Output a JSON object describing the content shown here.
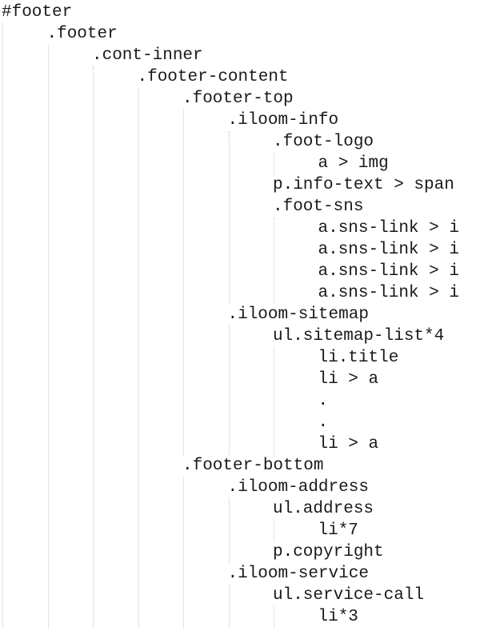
{
  "lines": [
    {
      "text": "#footer",
      "level": 0
    },
    {
      "text": ".footer",
      "level": 1
    },
    {
      "text": ".cont-inner",
      "level": 2
    },
    {
      "text": ".footer-content",
      "level": 3
    },
    {
      "text": ".footer-top",
      "level": 4
    },
    {
      "text": ".iloom-info",
      "level": 5
    },
    {
      "text": ".foot-logo",
      "level": 6
    },
    {
      "text": "a > img",
      "level": 7
    },
    {
      "text": "p.info-text > span",
      "level": 6
    },
    {
      "text": ".foot-sns",
      "level": 6
    },
    {
      "text": "a.sns-link > i",
      "level": 7
    },
    {
      "text": "a.sns-link > i",
      "level": 7
    },
    {
      "text": "a.sns-link > i",
      "level": 7
    },
    {
      "text": "a.sns-link > i",
      "level": 7
    },
    {
      "text": ".iloom-sitemap",
      "level": 5
    },
    {
      "text": "ul.sitemap-list*4",
      "level": 6
    },
    {
      "text": "li.title",
      "level": 7
    },
    {
      "text": "li > a",
      "level": 7
    },
    {
      "text": ".",
      "level": 7
    },
    {
      "text": ".",
      "level": 7
    },
    {
      "text": "li > a",
      "level": 7
    },
    {
      "text": ".footer-bottom",
      "level": 4
    },
    {
      "text": ".iloom-address",
      "level": 5
    },
    {
      "text": "ul.address",
      "level": 6
    },
    {
      "text": "li*7",
      "level": 7
    },
    {
      "text": "p.copyright",
      "level": 6
    },
    {
      "text": ".iloom-service",
      "level": 5
    },
    {
      "text": "ul.service-call",
      "level": 6
    },
    {
      "text": "li*3",
      "level": 7
    }
  ]
}
